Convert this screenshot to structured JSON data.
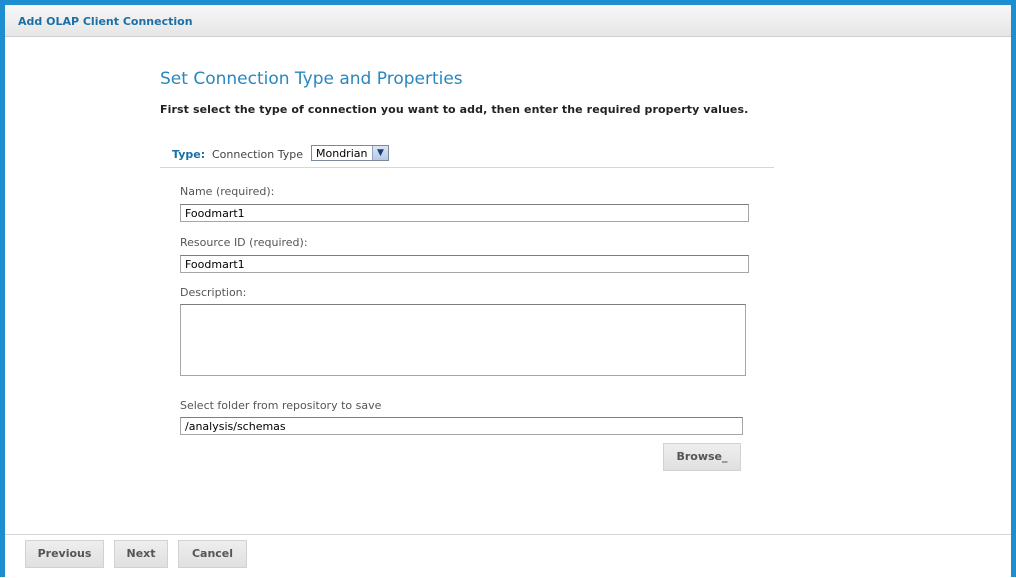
{
  "window": {
    "title": "Add OLAP Client Connection"
  },
  "main": {
    "heading": "Set Connection Type and Properties",
    "instructions": "First select the type of connection you want to add, then enter the required property values.",
    "type": {
      "label": "Type:",
      "sublabel": "Connection Type",
      "selected": "Mondrian"
    },
    "fields": {
      "name_label": "Name (required):",
      "name_value": "Foodmart1",
      "resource_id_label": "Resource ID (required):",
      "resource_id_value": "Foodmart1",
      "description_label": "Description:",
      "description_value": "",
      "folder_label": "Select folder from repository to save",
      "folder_value": "/analysis/schemas"
    },
    "browse_label": "Browse_"
  },
  "footer": {
    "previous_label": "Previous",
    "next_label": "Next",
    "cancel_label": "Cancel"
  },
  "colors": {
    "frame": "#1d8fd1",
    "heading": "#2a86be",
    "title": "#1b6fa7"
  }
}
